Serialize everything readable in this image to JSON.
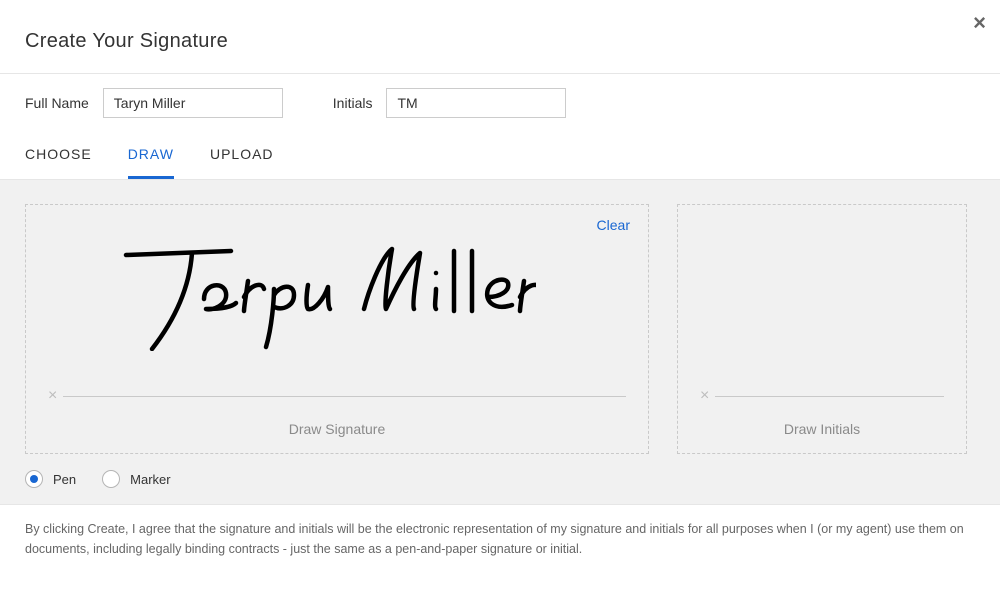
{
  "title": "Create Your Signature",
  "close_icon": "×",
  "fields": {
    "fullname_label": "Full Name",
    "fullname_value": "Taryn Miller",
    "initials_label": "Initials",
    "initials_value": "TM"
  },
  "tabs": {
    "choose": "CHOOSE",
    "draw": "DRAW",
    "upload": "UPLOAD"
  },
  "panels": {
    "clear": "Clear",
    "signature_label": "Draw Signature",
    "initials_label": "Draw Initials",
    "line_mark": "×"
  },
  "brush": {
    "pen": "Pen",
    "marker": "Marker"
  },
  "disclaimer": "By clicking Create, I agree that the signature and initials will be the electronic representation of my signature and initials for all purposes when I (or my agent) use them on documents, including legally binding contracts - just the same as a pen-and-paper signature or initial."
}
